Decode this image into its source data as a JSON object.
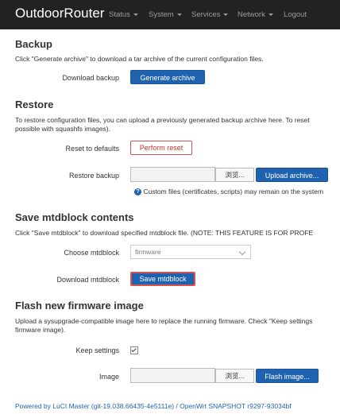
{
  "navbar": {
    "brand": "OutdoorRouter",
    "items": [
      {
        "label": "Status",
        "dropdown": true
      },
      {
        "label": "System",
        "dropdown": true
      },
      {
        "label": "Services",
        "dropdown": true
      },
      {
        "label": "Network",
        "dropdown": true
      },
      {
        "label": "Logout",
        "dropdown": false
      }
    ]
  },
  "backup": {
    "title": "Backup",
    "desc": "Click \"Generate archive\" to download a tar archive of the current configuration files.",
    "download_label": "Download backup",
    "generate_btn": "Generate archive"
  },
  "restore": {
    "title": "Restore",
    "desc_line1": "To restore configuration files, you can upload a previously generated backup archive here. To reset",
    "desc_line2": "possible with squashfs images).",
    "reset_label": "Reset to defaults",
    "reset_btn": "Perform reset",
    "restore_label": "Restore backup",
    "browse_btn": "浏览...",
    "upload_btn": "Upload archive...",
    "hint": "Custom files (certificates, scripts) may remain on the system"
  },
  "mtd": {
    "title": "Save mtdblock contents",
    "desc": "Click \"Save mtdblock\" to download specified mtdblock file. (NOTE: THIS FEATURE IS FOR PROFE",
    "choose_label": "Choose mtdblock",
    "choose_value": "firmware",
    "download_label": "Download mtdblock",
    "save_btn": "Save mtdblock"
  },
  "flash": {
    "title": "Flash new firmware image",
    "desc_line1": "Upload a sysupgrade-compatible image here to replace the running firmware. Check \"Keep settings",
    "desc_line2": "firmware image).",
    "keep_label": "Keep settings",
    "keep_checked": true,
    "image_label": "Image",
    "browse_btn": "浏览...",
    "flash_btn": "Flash image..."
  },
  "footer": {
    "text": "Powered by LuCI Master (git-19.038.66435-4e5111e) / OpenWrt SNAPSHOT r9297-93034bf"
  },
  "colors": {
    "navbar_bg": "#222222",
    "primary": "#1f63b0",
    "danger": "#d9534f"
  }
}
